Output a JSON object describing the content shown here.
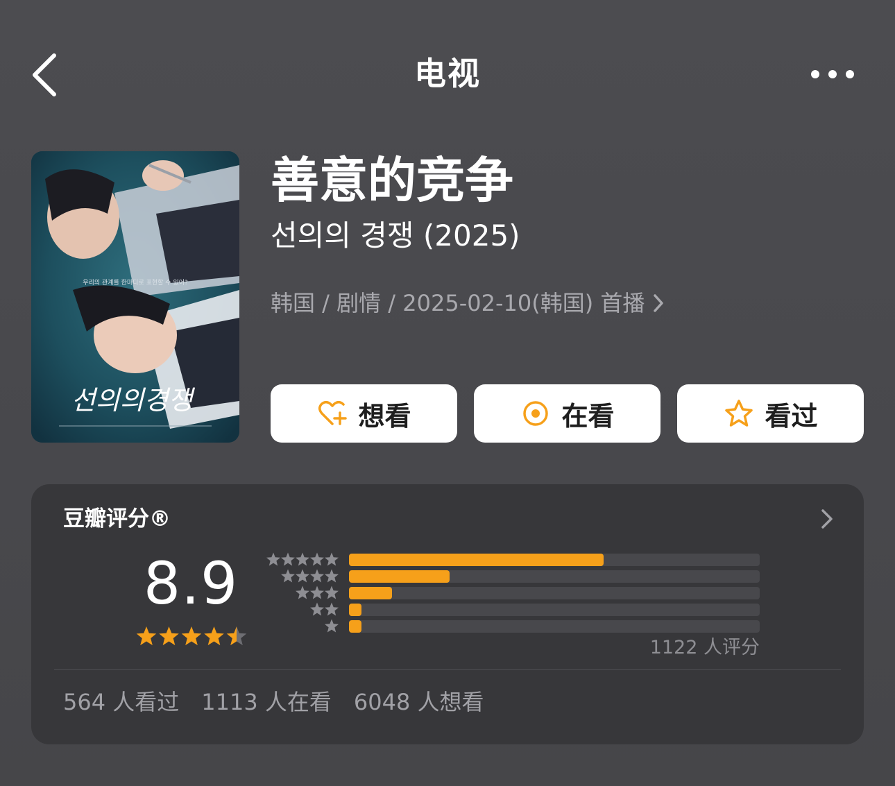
{
  "header": {
    "title": "电视",
    "back_icon": "chevron-left-icon",
    "more_icon": "more-dots-icon"
  },
  "show": {
    "title": "善意的竞争",
    "original_title": "선의의 경쟁 (2025)",
    "meta": "韩国 / 剧情 / 2025-02-10(韩国) 首播",
    "poster": {
      "title_text": "선의의경쟁",
      "tagline": "우리의 관계를 한마디로 표현할 수 있어?"
    }
  },
  "actions": [
    {
      "label": "想看",
      "icon": "heart-plus-icon"
    },
    {
      "label": "在看",
      "icon": "target-circle-icon"
    },
    {
      "label": "看过",
      "icon": "star-outline-icon"
    }
  ],
  "rating": {
    "title": "豆瓣评分®",
    "score": "8.9",
    "stars": 4.5,
    "distribution": [
      {
        "stars": 5,
        "fraction": 0.62
      },
      {
        "stars": 4,
        "fraction": 0.245
      },
      {
        "stars": 3,
        "fraction": 0.105
      },
      {
        "stars": 2,
        "fraction": 0.02
      },
      {
        "stars": 1,
        "fraction": 0.02
      }
    ],
    "total_label": "1122 人评分",
    "stats": {
      "watched": "564 人看过",
      "watching": "1113 人在看",
      "want": "6048 人想看"
    }
  },
  "colors": {
    "accent": "#f6a01a",
    "background": "#4a4a4e",
    "card": "#37373a",
    "muted_text": "#a9a9ae"
  }
}
